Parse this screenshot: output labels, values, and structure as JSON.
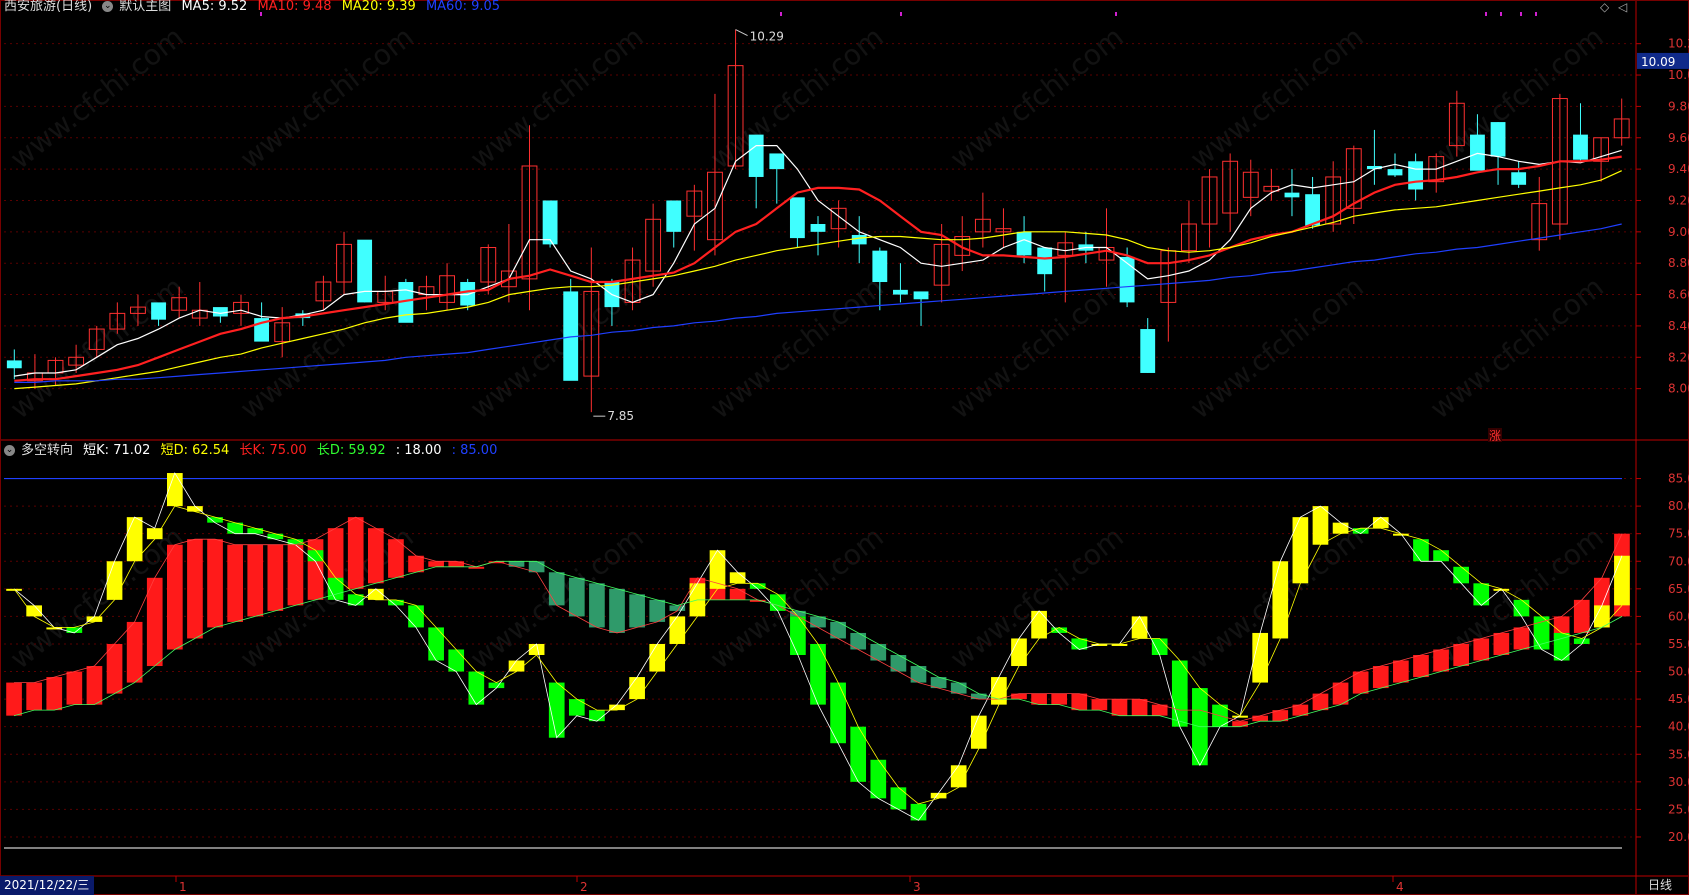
{
  "colors": {
    "up": "#ff3030",
    "down": "#40ffff",
    "ma5": "#ffffff",
    "ma10": "#ff2020",
    "ma20": "#ffff00",
    "ma60": "#1f3fff",
    "bull": "#ff1a1a",
    "bear": "#2f9a6a",
    "yup": "#ffff00",
    "ydn": "#00ff00"
  },
  "main_header": {
    "title": "西安旅游(日线)",
    "indicator": "默认主图",
    "ma5": "MA5: 9.52",
    "ma10": "MA10: 9.48",
    "ma20": "MA20: 9.39",
    "ma60": "MA60: 9.05"
  },
  "sub_header": {
    "title": "多空转向",
    "short_k": "短K: 71.02",
    "short_d": "短D: 62.54",
    "long_k": "长K: 75.00",
    "long_d": "长D: 59.92",
    "l18": ": 18.00",
    "l85": ": 85.00"
  },
  "price_axis": {
    "ticks": [
      "10.20",
      "10.00",
      "9.80",
      "9.60",
      "9.40",
      "9.20",
      "9.00",
      "8.80",
      "8.60",
      "8.40",
      "8.20",
      "8.00"
    ],
    "current": "10.09"
  },
  "ind_axis": {
    "ticks": [
      "85.00",
      "80.00",
      "75.00",
      "70.00",
      "65.00",
      "60.00",
      "55.00",
      "50.00",
      "45.00",
      "40.00",
      "35.00",
      "30.00",
      "25.00",
      "20.00"
    ]
  },
  "annotations": {
    "high": "10.29",
    "low": "7.85",
    "zhang": "涨"
  },
  "bottom_bar": {
    "date": "2021/12/22/三",
    "months": [
      "1",
      "2",
      "3",
      "4"
    ],
    "period": "日线"
  },
  "watermark": "www.cfchi.com",
  "chart_data": [
    {
      "type": "candlestick",
      "title": "西安旅游(日线)",
      "ylim": [
        7.8,
        10.3
      ],
      "ohlc": [
        [
          8.18,
          8.25,
          8.06,
          8.13
        ],
        [
          8.05,
          8.22,
          8.0,
          8.1
        ],
        [
          8.1,
          8.2,
          8.02,
          8.18
        ],
        [
          8.15,
          8.28,
          8.1,
          8.2
        ],
        [
          8.25,
          8.4,
          8.2,
          8.38
        ],
        [
          8.38,
          8.55,
          8.35,
          8.48
        ],
        [
          8.48,
          8.6,
          8.4,
          8.52
        ],
        [
          8.55,
          8.5,
          8.4,
          8.44
        ],
        [
          8.5,
          8.65,
          8.45,
          8.58
        ],
        [
          8.45,
          8.68,
          8.4,
          8.5
        ],
        [
          8.52,
          8.5,
          8.42,
          8.46
        ],
        [
          8.48,
          8.6,
          8.4,
          8.55
        ],
        [
          8.45,
          8.55,
          8.38,
          8.3
        ],
        [
          8.3,
          8.52,
          8.2,
          8.42
        ],
        [
          8.48,
          8.5,
          8.4,
          8.45
        ],
        [
          8.56,
          8.72,
          8.5,
          8.68
        ],
        [
          8.68,
          9.0,
          8.6,
          8.92
        ],
        [
          8.95,
          8.85,
          8.55,
          8.55
        ],
        [
          8.55,
          8.72,
          8.5,
          8.62
        ],
        [
          8.68,
          8.7,
          8.45,
          8.42
        ],
        [
          8.6,
          8.72,
          8.5,
          8.65
        ],
        [
          8.55,
          8.8,
          8.5,
          8.72
        ],
        [
          8.68,
          8.7,
          8.5,
          8.53
        ],
        [
          8.68,
          8.92,
          8.6,
          8.9
        ],
        [
          8.65,
          9.05,
          8.55,
          8.75
        ],
        [
          8.7,
          9.68,
          8.5,
          9.42
        ],
        [
          9.2,
          9.18,
          8.9,
          8.92
        ],
        [
          8.62,
          8.7,
          8.1,
          8.05
        ],
        [
          8.08,
          8.9,
          7.85,
          8.62
        ],
        [
          8.68,
          8.7,
          8.4,
          8.52
        ],
        [
          8.55,
          8.9,
          8.5,
          8.82
        ],
        [
          8.75,
          9.18,
          8.65,
          9.08
        ],
        [
          9.2,
          9.15,
          8.9,
          9.0
        ],
        [
          9.1,
          9.3,
          8.88,
          9.26
        ],
        [
          8.95,
          9.88,
          8.85,
          9.38
        ],
        [
          9.42,
          10.29,
          9.4,
          10.06
        ],
        [
          9.62,
          9.55,
          9.15,
          9.35
        ],
        [
          9.5,
          9.48,
          9.18,
          9.4
        ],
        [
          9.22,
          9.15,
          8.9,
          8.96
        ],
        [
          9.05,
          9.1,
          8.85,
          9.0
        ],
        [
          9.02,
          9.2,
          8.9,
          9.15
        ],
        [
          8.98,
          9.1,
          8.8,
          8.92
        ],
        [
          8.88,
          8.9,
          8.5,
          8.68
        ],
        [
          8.63,
          8.8,
          8.55,
          8.6
        ],
        [
          8.62,
          8.6,
          8.4,
          8.57
        ],
        [
          8.66,
          9.05,
          8.55,
          8.92
        ],
        [
          8.85,
          9.1,
          8.75,
          8.97
        ],
        [
          9.0,
          9.25,
          8.9,
          9.08
        ],
        [
          9.0,
          9.15,
          8.9,
          9.02
        ],
        [
          9.0,
          9.1,
          8.8,
          8.85
        ],
        [
          8.9,
          8.9,
          8.62,
          8.73
        ],
        [
          8.85,
          9.0,
          8.55,
          8.93
        ],
        [
          8.92,
          9.0,
          8.8,
          8.88
        ],
        [
          8.82,
          9.15,
          8.65,
          8.9
        ],
        [
          8.84,
          8.9,
          8.52,
          8.55
        ],
        [
          8.38,
          8.45,
          8.1,
          8.1
        ],
        [
          8.55,
          8.9,
          8.3,
          8.88
        ],
        [
          8.88,
          9.2,
          8.8,
          9.05
        ],
        [
          9.05,
          9.4,
          8.9,
          9.35
        ],
        [
          9.12,
          9.5,
          9.0,
          9.45
        ],
        [
          9.22,
          9.46,
          9.1,
          9.38
        ],
        [
          9.26,
          9.4,
          9.2,
          9.29
        ],
        [
          9.25,
          9.4,
          9.1,
          9.22
        ],
        [
          9.24,
          9.35,
          9.02,
          9.04
        ],
        [
          9.05,
          9.45,
          9.0,
          9.35
        ],
        [
          9.15,
          9.55,
          9.05,
          9.53
        ],
        [
          9.42,
          9.65,
          9.3,
          9.4
        ],
        [
          9.4,
          9.5,
          9.35,
          9.36
        ],
        [
          9.45,
          9.5,
          9.2,
          9.27
        ],
        [
          9.32,
          9.5,
          9.25,
          9.48
        ],
        [
          9.55,
          9.9,
          9.48,
          9.82
        ],
        [
          9.62,
          9.75,
          9.4,
          9.39
        ],
        [
          9.7,
          9.7,
          9.3,
          9.48
        ],
        [
          9.38,
          9.45,
          9.28,
          9.3
        ],
        [
          8.95,
          9.35,
          8.88,
          9.18
        ],
        [
          9.05,
          9.88,
          8.95,
          9.85
        ],
        [
          9.62,
          9.82,
          9.45,
          9.46
        ],
        [
          9.45,
          9.6,
          9.32,
          9.6
        ],
        [
          9.6,
          9.85,
          9.55,
          9.72
        ]
      ],
      "series": [
        {
          "name": "MA5",
          "values": [
            8.08,
            8.1,
            8.1,
            8.12,
            8.2,
            8.28,
            8.32,
            8.38,
            8.45,
            8.5,
            8.48,
            8.5,
            8.46,
            8.45,
            8.47,
            8.5,
            8.6,
            8.62,
            8.62,
            8.63,
            8.6,
            8.6,
            8.6,
            8.65,
            8.7,
            8.95,
            8.95,
            8.75,
            8.7,
            8.6,
            8.55,
            8.6,
            8.8,
            9.05,
            9.15,
            9.45,
            9.55,
            9.55,
            9.4,
            9.2,
            9.1,
            9.0,
            8.95,
            8.9,
            8.8,
            8.78,
            8.8,
            8.82,
            8.9,
            8.95,
            8.9,
            8.88,
            8.9,
            8.9,
            8.8,
            8.7,
            8.72,
            8.75,
            8.82,
            8.95,
            9.15,
            9.25,
            9.3,
            9.28,
            9.3,
            9.32,
            9.4,
            9.43,
            9.4,
            9.4,
            9.45,
            9.5,
            9.48,
            9.45,
            9.43,
            9.45,
            9.44,
            9.48,
            9.52
          ]
        },
        {
          "name": "MA10",
          "values": [
            8.05,
            8.06,
            8.06,
            8.08,
            8.1,
            8.12,
            8.15,
            8.2,
            8.25,
            8.3,
            8.35,
            8.38,
            8.42,
            8.45,
            8.46,
            8.48,
            8.5,
            8.52,
            8.54,
            8.56,
            8.58,
            8.6,
            8.62,
            8.63,
            8.7,
            8.72,
            8.76,
            8.72,
            8.68,
            8.68,
            8.7,
            8.72,
            8.74,
            8.8,
            8.9,
            9.0,
            9.05,
            9.15,
            9.25,
            9.28,
            9.28,
            9.27,
            9.2,
            9.1,
            9.0,
            8.98,
            8.9,
            8.85,
            8.85,
            8.84,
            8.83,
            8.84,
            8.86,
            8.88,
            8.85,
            8.8,
            8.8,
            8.82,
            8.85,
            8.9,
            8.95,
            8.98,
            9.0,
            9.05,
            9.1,
            9.18,
            9.25,
            9.3,
            9.32,
            9.33,
            9.35,
            9.38,
            9.4,
            9.4,
            9.42,
            9.45,
            9.45,
            9.46,
            9.48
          ]
        },
        {
          "name": "MA20",
          "values": [
            8.0,
            8.01,
            8.02,
            8.03,
            8.05,
            8.07,
            8.09,
            8.11,
            8.14,
            8.17,
            8.2,
            8.22,
            8.26,
            8.29,
            8.32,
            8.35,
            8.38,
            8.42,
            8.45,
            8.47,
            8.48,
            8.5,
            8.52,
            8.55,
            8.6,
            8.62,
            8.64,
            8.65,
            8.65,
            8.66,
            8.68,
            8.7,
            8.72,
            8.75,
            8.78,
            8.82,
            8.85,
            8.88,
            8.9,
            8.92,
            8.94,
            8.96,
            8.97,
            8.97,
            8.96,
            8.95,
            8.95,
            8.96,
            8.98,
            9.0,
            9.0,
            9.0,
            8.99,
            8.98,
            8.95,
            8.9,
            8.88,
            8.87,
            8.88,
            8.9,
            8.93,
            8.97,
            9.0,
            9.03,
            9.06,
            9.1,
            9.12,
            9.14,
            9.15,
            9.16,
            9.18,
            9.2,
            9.22,
            9.24,
            9.26,
            9.28,
            9.3,
            9.33,
            9.39
          ]
        },
        {
          "name": "MA60",
          "values": [
            8.04,
            8.04,
            8.05,
            8.05,
            8.05,
            8.06,
            8.06,
            8.07,
            8.08,
            8.09,
            8.1,
            8.11,
            8.12,
            8.13,
            8.14,
            8.15,
            8.16,
            8.17,
            8.18,
            8.2,
            8.21,
            8.22,
            8.23,
            8.25,
            8.27,
            8.29,
            8.31,
            8.33,
            8.34,
            8.36,
            8.37,
            8.39,
            8.4,
            8.42,
            8.43,
            8.45,
            8.46,
            8.48,
            8.49,
            8.5,
            8.51,
            8.52,
            8.53,
            8.54,
            8.55,
            8.56,
            8.57,
            8.58,
            8.59,
            8.6,
            8.61,
            8.62,
            8.63,
            8.64,
            8.65,
            8.66,
            8.67,
            8.68,
            8.69,
            8.71,
            8.72,
            8.74,
            8.75,
            8.77,
            8.79,
            8.81,
            8.82,
            8.84,
            8.86,
            8.87,
            8.89,
            8.9,
            8.92,
            8.94,
            8.96,
            8.98,
            9.0,
            9.02,
            9.05
          ]
        }
      ]
    },
    {
      "type": "bar",
      "title": "多空转向",
      "ylim": [
        18,
        88
      ],
      "short_k": [
        65,
        62,
        58,
        57,
        60,
        70,
        78,
        76,
        86,
        80,
        77,
        75,
        75,
        74,
        73,
        70,
        63,
        62,
        65,
        62,
        58,
        52,
        50,
        44,
        47,
        52,
        55,
        38,
        42,
        41,
        44,
        49,
        55,
        60,
        66,
        72,
        68,
        65,
        61,
        53,
        44,
        37,
        30,
        27,
        25,
        23,
        28,
        33,
        42,
        49,
        56,
        61,
        57,
        54,
        55,
        55,
        60,
        53,
        40,
        33,
        40,
        42,
        57,
        70,
        78,
        80,
        77,
        75,
        78,
        75,
        70,
        70,
        66,
        62,
        65,
        60,
        54,
        52,
        55,
        62,
        71
      ],
      "short_d": [
        65,
        60,
        58,
        58,
        59,
        63,
        70,
        74,
        80,
        79,
        78,
        77,
        76,
        75,
        74,
        72,
        67,
        64,
        63,
        63,
        62,
        58,
        54,
        50,
        48,
        50,
        53,
        48,
        45,
        43,
        43,
        45,
        50,
        55,
        60,
        65,
        66,
        66,
        64,
        60,
        55,
        48,
        40,
        34,
        29,
        26,
        27,
        29,
        36,
        44,
        51,
        56,
        58,
        56,
        55,
        55,
        56,
        56,
        52,
        47,
        44,
        42,
        48,
        56,
        66,
        73,
        75,
        76,
        76,
        75,
        74,
        72,
        69,
        66,
        65,
        63,
        60,
        57,
        56,
        58,
        62
      ],
      "long_k": [
        48,
        48,
        49,
        50,
        51,
        55,
        59,
        67,
        73,
        74,
        74,
        73,
        73,
        73,
        73,
        74,
        76,
        78,
        76,
        74,
        71,
        70,
        70,
        69,
        70,
        69,
        68,
        62,
        60,
        58,
        57,
        58,
        59,
        61,
        67,
        66,
        65,
        63,
        62,
        60,
        58,
        56,
        54,
        52,
        50,
        48,
        47,
        46,
        45,
        45,
        46,
        46,
        46,
        46,
        45,
        45,
        45,
        44,
        43,
        43,
        42,
        41,
        42,
        43,
        44,
        46,
        48,
        50,
        51,
        52,
        53,
        54,
        55,
        56,
        57,
        58,
        59,
        60,
        63,
        67,
        75
      ],
      "long_d": [
        42,
        43,
        43,
        44,
        44,
        46,
        48,
        51,
        54,
        56,
        58,
        59,
        60,
        61,
        62,
        63,
        64,
        65,
        66,
        67,
        68,
        69,
        69,
        69,
        70,
        70,
        70,
        68,
        67,
        66,
        65,
        64,
        63,
        62,
        63,
        63,
        63,
        63,
        62,
        61,
        60,
        59,
        57,
        55,
        53,
        51,
        49,
        48,
        46,
        45,
        45,
        44,
        44,
        43,
        43,
        42,
        42,
        42,
        41,
        40,
        40,
        40,
        41,
        41,
        42,
        43,
        44,
        46,
        47,
        48,
        49,
        50,
        51,
        52,
        53,
        54,
        55,
        56,
        57,
        58,
        60
      ]
    }
  ]
}
